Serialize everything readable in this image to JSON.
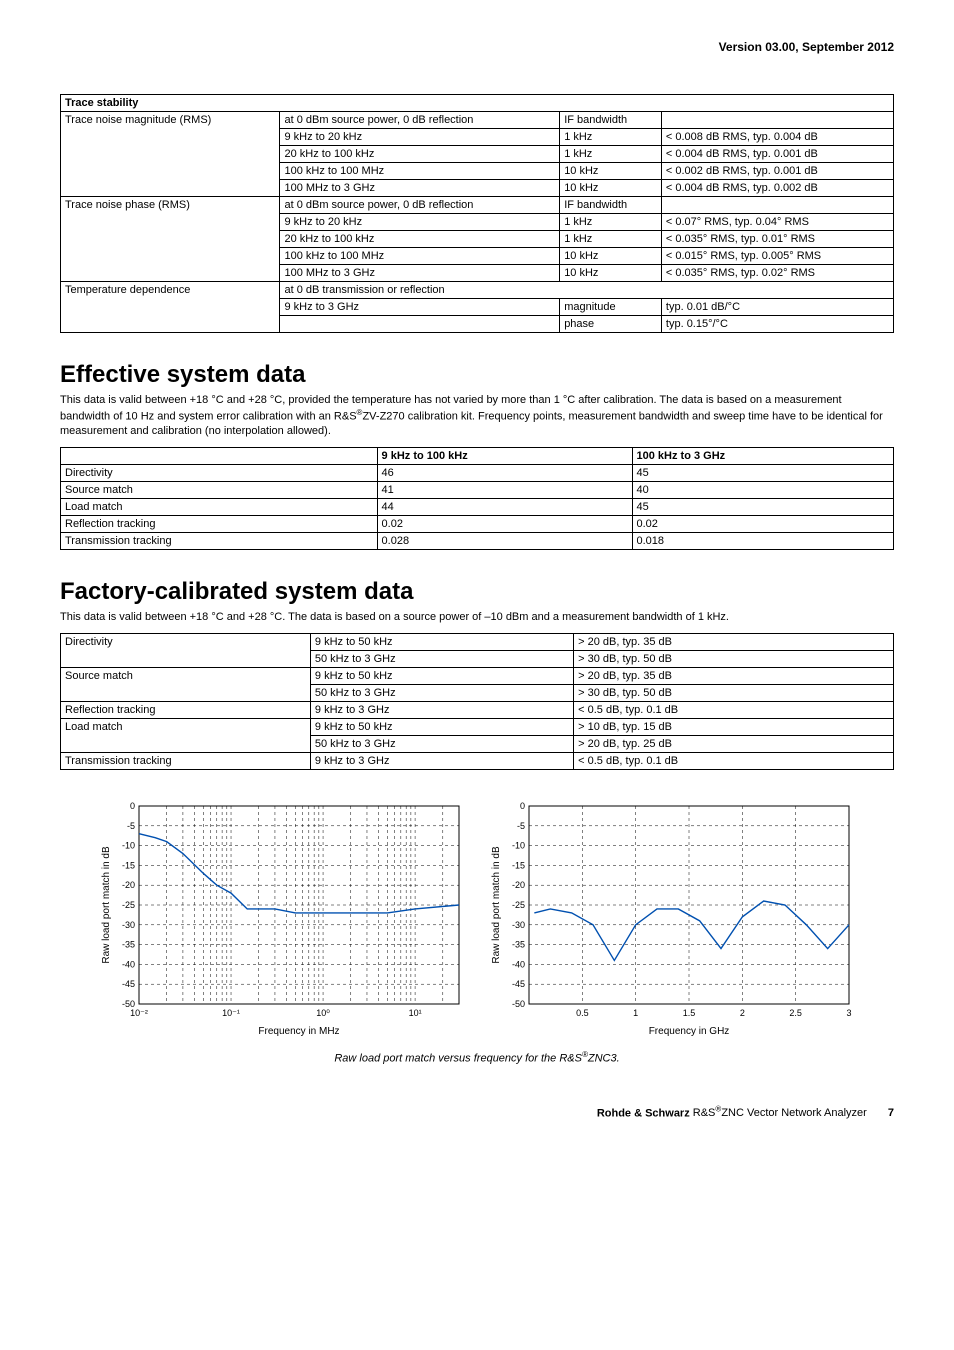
{
  "header": {
    "version": "Version 03.00, September 2012"
  },
  "table1": {
    "title": "Trace stability",
    "rows": [
      {
        "label": "Trace noise magnitude (RMS)",
        "cond": "at 0 dBm source power, 0 dB reflection",
        "c3": "IF bandwidth",
        "c4": ""
      },
      {
        "label": "",
        "cond": "9 kHz to 20 kHz",
        "c3": "1 kHz",
        "c4": "< 0.008 dB RMS, typ. 0.004 dB"
      },
      {
        "label": "",
        "cond": "20 kHz to 100 kHz",
        "c3": "1 kHz",
        "c4": "< 0.004 dB RMS, typ. 0.001 dB"
      },
      {
        "label": "",
        "cond": "100 kHz to 100 MHz",
        "c3": "10 kHz",
        "c4": "< 0.002 dB RMS, typ. 0.001 dB"
      },
      {
        "label": "",
        "cond": "100 MHz to 3 GHz",
        "c3": "10 kHz",
        "c4": "< 0.004 dB RMS, typ. 0.002 dB"
      },
      {
        "label": "Trace noise phase (RMS)",
        "cond": "at 0 dBm source power, 0 dB reflection",
        "c3": "IF bandwidth",
        "c4": ""
      },
      {
        "label": "",
        "cond": "9 kHz to 20 kHz",
        "c3": "1 kHz",
        "c4": "< 0.07° RMS, typ. 0.04° RMS"
      },
      {
        "label": "",
        "cond": "20 kHz to 100 kHz",
        "c3": "1 kHz",
        "c4": "< 0.035° RMS, typ. 0.01° RMS"
      },
      {
        "label": "",
        "cond": "100 kHz to 100 MHz",
        "c3": "10 kHz",
        "c4": "< 0.015° RMS, typ. 0.005° RMS"
      },
      {
        "label": "",
        "cond": "100 MHz to 3 GHz",
        "c3": "10 kHz",
        "c4": "< 0.035° RMS, typ. 0.02° RMS"
      },
      {
        "label": "Temperature dependence",
        "cond": "at 0 dB transmission or reflection",
        "c3": "",
        "c4": "",
        "merge34": true
      },
      {
        "label": "",
        "cond": "9 kHz to 3 GHz",
        "c3": "magnitude",
        "c4": "typ. 0.01 dB/°C"
      },
      {
        "label": "",
        "cond": "",
        "c3": "phase",
        "c4": "typ. 0.15°/°C"
      }
    ]
  },
  "section2": {
    "heading": "Effective system data",
    "desc": "This data is valid between +18 °C and +28 °C, provided the temperature has not varied by more than 1 °C after calibration. The data is based on a measurement bandwidth of 10 Hz and system error calibration with an R&S®ZV-Z270 calibration kit. Frequency points, measurement bandwidth and sweep time have to be identical for measurement and calibration (no interpolation allowed).",
    "h1": "9 kHz to 100 kHz",
    "h2": "100 kHz to 3 GHz",
    "rows": [
      {
        "l": "Directivity",
        "a": "46",
        "b": "45"
      },
      {
        "l": "Source match",
        "a": "41",
        "b": "40"
      },
      {
        "l": "Load match",
        "a": "44",
        "b": "45"
      },
      {
        "l": "Reflection tracking",
        "a": "0.02",
        "b": "0.02"
      },
      {
        "l": "Transmission tracking",
        "a": "0.028",
        "b": "0.018"
      }
    ]
  },
  "section3": {
    "heading": "Factory-calibrated system data",
    "desc": "This data is valid between +18 °C and +28 °C. The data is based on a source power of –10 dBm and a measurement bandwidth of 1 kHz.",
    "rows": [
      {
        "l": "Directivity",
        "f": "9 kHz to 50 kHz",
        "v": "> 20 dB, typ. 35 dB"
      },
      {
        "l": "",
        "f": "50 kHz to 3 GHz",
        "v": "> 30 dB, typ. 50 dB"
      },
      {
        "l": "Source match",
        "f": "9 kHz to 50 kHz",
        "v": "> 20 dB, typ. 35 dB"
      },
      {
        "l": "",
        "f": "50 kHz to 3 GHz",
        "v": "> 30 dB, typ. 50 dB"
      },
      {
        "l": "Reflection tracking",
        "f": "9 kHz to 3 GHz",
        "v": "< 0.5 dB, typ. 0.1 dB"
      },
      {
        "l": "Load match",
        "f": "9 kHz to 50 kHz",
        "v": "> 10 dB, typ. 15 dB"
      },
      {
        "l": "",
        "f": "50 kHz to 3 GHz",
        "v": "> 20 dB, typ. 25 dB"
      },
      {
        "l": "Transmission tracking",
        "f": "9 kHz to 3 GHz",
        "v": "< 0.5 dB, typ. 0.1 dB"
      }
    ]
  },
  "charts": {
    "caption": "Raw load port match versus frequency for the R&S®ZNC3.",
    "ylabel": "Raw load port match in dB",
    "left": {
      "xlabel": "Frequency in MHz",
      "xticks": [
        "10⁻²",
        "10⁻¹",
        "10⁰",
        "10¹"
      ],
      "yticks": [
        "0",
        "-5",
        "-10",
        "-15",
        "-20",
        "-25",
        "-30",
        "-35",
        "-40",
        "-45",
        "-50"
      ]
    },
    "right": {
      "xlabel": "Frequency in GHz",
      "xticks": [
        "0.5",
        "1",
        "1.5",
        "2",
        "2.5",
        "3"
      ],
      "yticks": [
        "0",
        "-5",
        "-10",
        "-15",
        "-20",
        "-25",
        "-30",
        "-35",
        "-40",
        "-45",
        "-50"
      ]
    }
  },
  "chart_data": [
    {
      "type": "line",
      "title": "",
      "ylabel": "Raw load port match in dB",
      "xlabel": "Frequency in MHz",
      "x_scale": "log",
      "xlim": [
        0.01,
        30
      ],
      "ylim": [
        -50,
        0
      ],
      "series": [
        {
          "name": "trace",
          "x": [
            0.01,
            0.015,
            0.02,
            0.03,
            0.05,
            0.07,
            0.1,
            0.15,
            0.2,
            0.3,
            0.5,
            0.7,
            1,
            2,
            5,
            10,
            30
          ],
          "y": [
            -7,
            -8,
            -9,
            -12,
            -17,
            -20,
            -22,
            -26,
            -26,
            -26,
            -27,
            -27,
            -27,
            -27,
            -27,
            -26,
            -25
          ]
        }
      ]
    },
    {
      "type": "line",
      "title": "",
      "ylabel": "Raw load port match in dB",
      "xlabel": "Frequency in GHz",
      "xlim": [
        0,
        3
      ],
      "ylim": [
        -50,
        0
      ],
      "series": [
        {
          "name": "trace",
          "x": [
            0.05,
            0.2,
            0.4,
            0.6,
            0.8,
            1.0,
            1.2,
            1.4,
            1.6,
            1.8,
            2.0,
            2.2,
            2.4,
            2.6,
            2.8,
            3.0
          ],
          "y": [
            -27,
            -26,
            -27,
            -30,
            -39,
            -30,
            -26,
            -26,
            -29,
            -36,
            -28,
            -24,
            -25,
            -30,
            -36,
            -30
          ]
        }
      ]
    }
  ],
  "footer": {
    "brand": "Rohde & Schwarz",
    "product": "R&S®ZNC Vector Network Analyzer",
    "page": "7"
  }
}
